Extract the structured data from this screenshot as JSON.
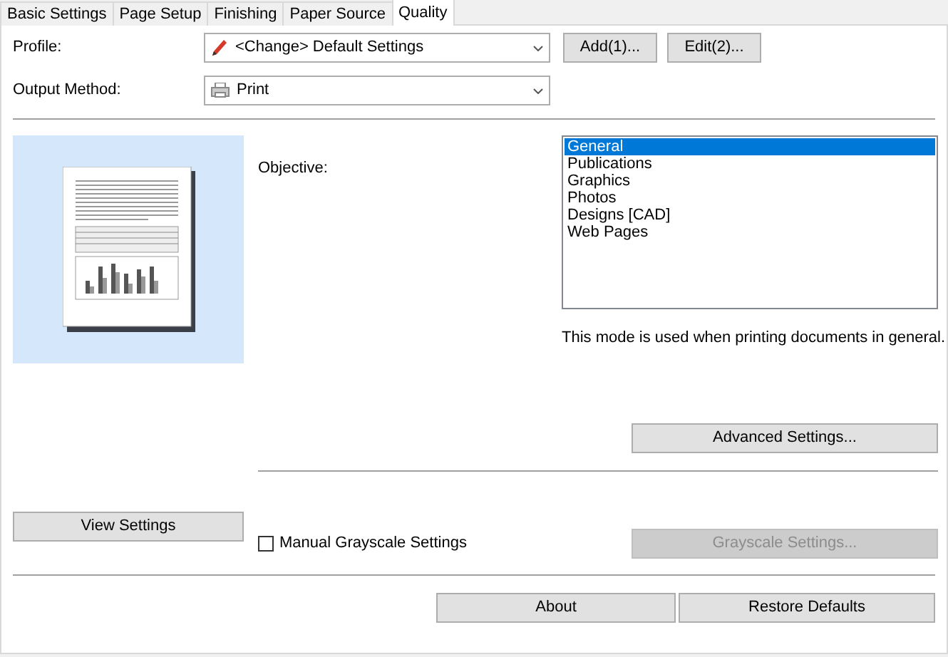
{
  "tabs": [
    {
      "label": "Basic Settings",
      "selected": false
    },
    {
      "label": "Page Setup",
      "selected": false
    },
    {
      "label": "Finishing",
      "selected": false
    },
    {
      "label": "Paper Source",
      "selected": false
    },
    {
      "label": "Quality",
      "selected": true
    }
  ],
  "profile": {
    "label": "Profile:",
    "value": "<Change> Default Settings",
    "buttons": [
      "Add(1)...",
      "Edit(2)..."
    ]
  },
  "output_method": {
    "label": "Output Method:",
    "value": "Print"
  },
  "objective": {
    "label": "Objective:",
    "items": [
      {
        "label": "General",
        "selected": true
      },
      {
        "label": "Publications",
        "selected": false
      },
      {
        "label": "Graphics",
        "selected": false
      },
      {
        "label": "Photos",
        "selected": false
      },
      {
        "label": "Designs [CAD]",
        "selected": false
      },
      {
        "label": "Web Pages",
        "selected": false
      }
    ],
    "description": "This mode is used when printing documents in general."
  },
  "advanced_button": {
    "label": "Advanced Settings...",
    "disabled": false
  },
  "view_settings_button": {
    "label": "View Settings",
    "disabled": false
  },
  "manual_grayscale": {
    "label": "Manual Grayscale Settings",
    "checked": false
  },
  "grayscale_button": {
    "label": "Grayscale Settings...",
    "disabled": true
  },
  "footer_buttons": [
    {
      "label": "About",
      "disabled": false
    },
    {
      "label": "Restore Defaults",
      "disabled": false
    }
  ]
}
